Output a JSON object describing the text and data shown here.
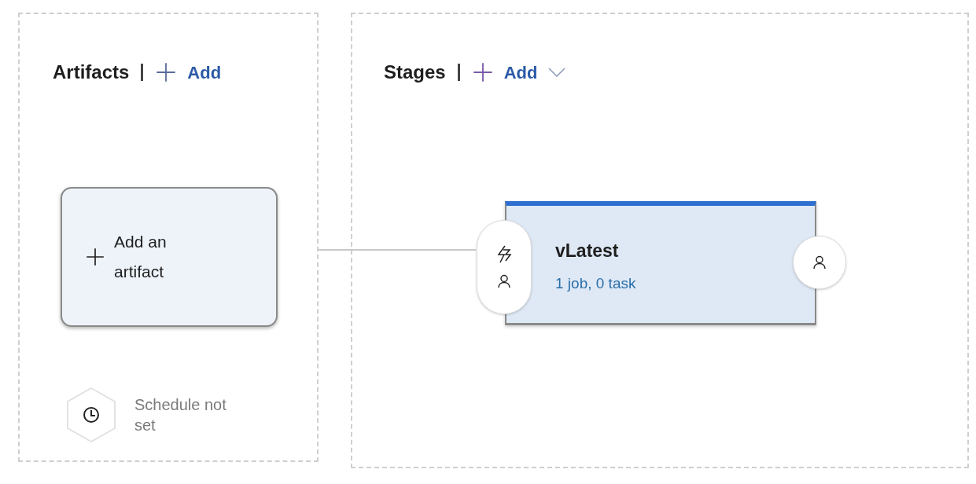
{
  "artifacts": {
    "title": "Artifacts",
    "add_label": "Add",
    "card_text": "Add an artifact",
    "schedule_text": "Schedule not set"
  },
  "stages": {
    "title": "Stages",
    "add_label": "Add",
    "items": [
      {
        "name": "vLatest",
        "summary": "1 job, 0 task"
      }
    ]
  }
}
